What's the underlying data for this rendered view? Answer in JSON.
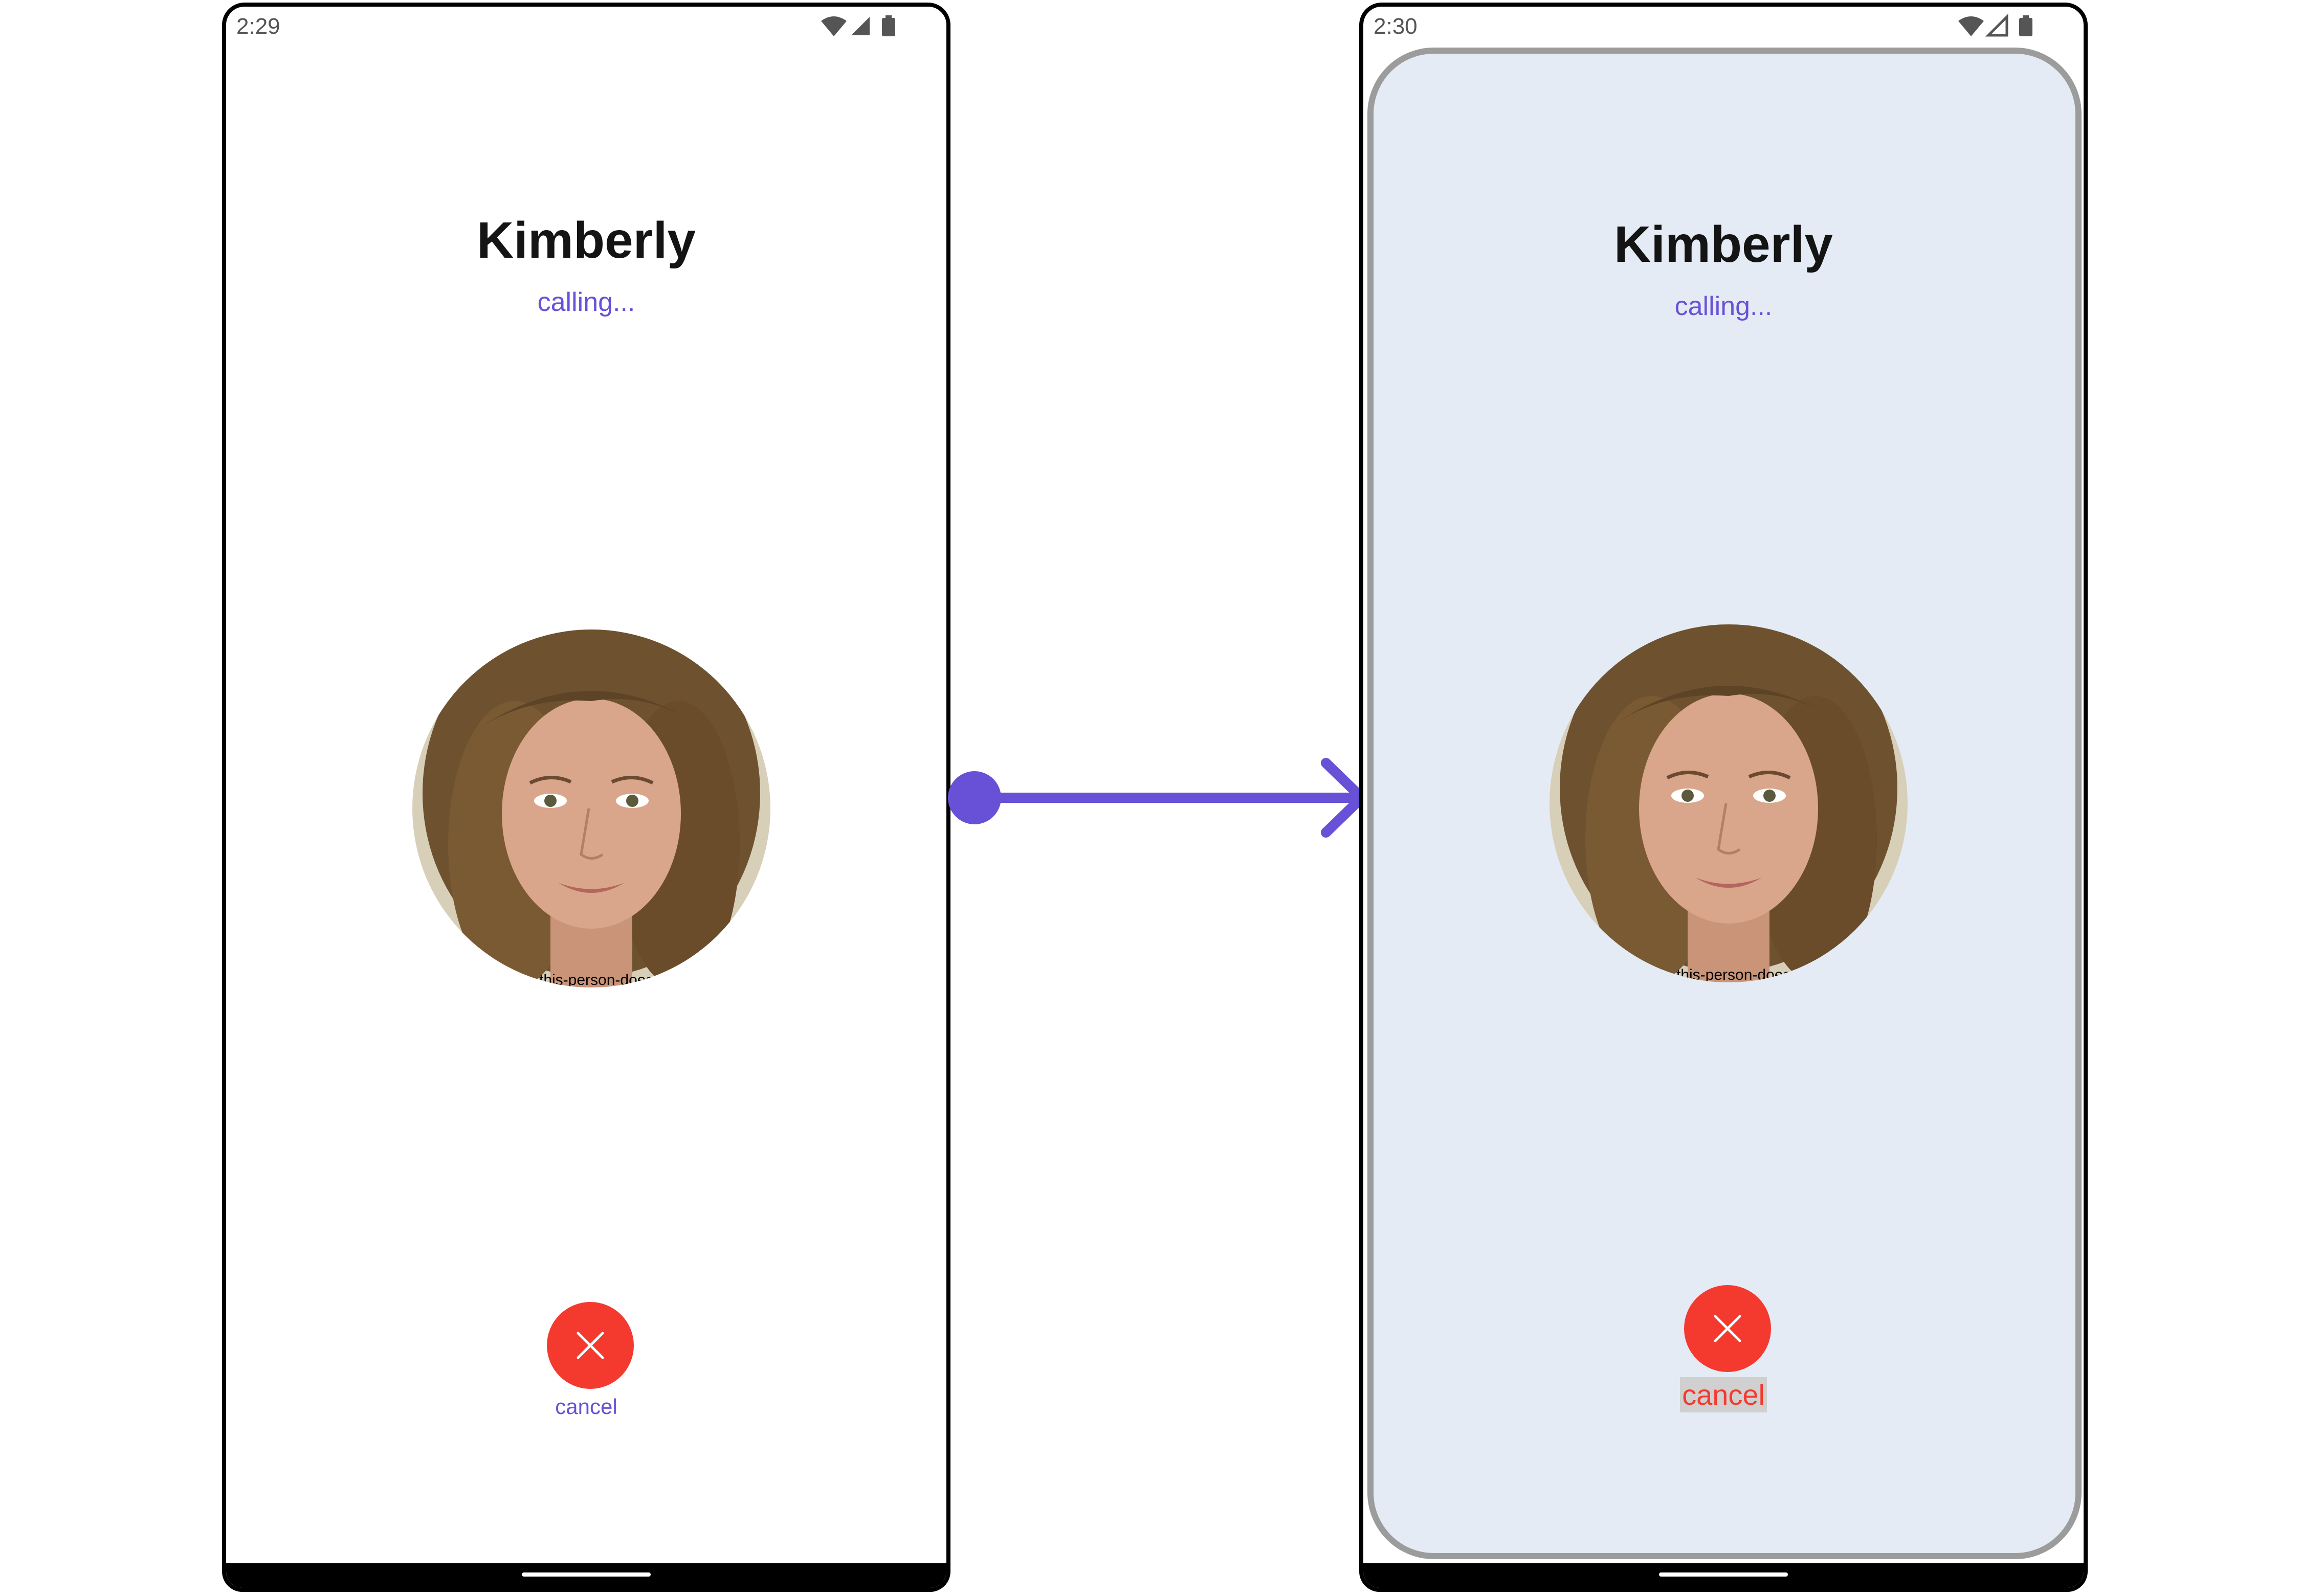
{
  "screens": [
    {
      "time": "2:29",
      "caller_name": "Kimberly",
      "call_status": "calling...",
      "avatar_watermark": "this-person-does",
      "cancel_label": "cancel"
    },
    {
      "time": "2:30",
      "caller_name": "Kimberly",
      "call_status": "calling...",
      "avatar_watermark": "this-person-does",
      "cancel_label": "cancel"
    }
  ],
  "colors": {
    "accent": "#6851d6",
    "decline": "#f43a2f",
    "styled_background": "#e4ebf5",
    "styled_border": "#9c9c9c",
    "styled_label_highlight": "#d0d0d0"
  },
  "icons": {
    "wifi": "wifi-icon",
    "signal": "signal-icon",
    "battery": "battery-icon",
    "decline": "close-icon",
    "connector": "arrow-right-icon"
  }
}
